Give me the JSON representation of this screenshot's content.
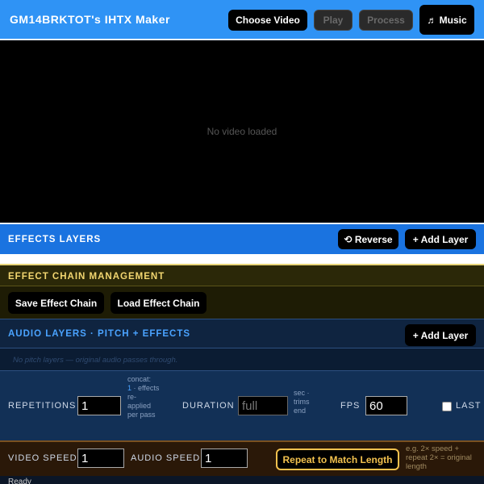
{
  "header": {
    "title": "GM14BRKTOT's IHTX Maker",
    "choose_video": "Choose Video",
    "play": "Play",
    "process": "Process",
    "music": "♬ Music"
  },
  "video": {
    "empty_message": "No video loaded"
  },
  "effects_layers": {
    "title": "EFFECTS LAYERS",
    "reverse": "⟲ Reverse",
    "add_layer": "+ Add Layer"
  },
  "effect_chain": {
    "title": "EFFECT CHAIN MANAGEMENT",
    "save": "Save Effect Chain",
    "load": "Load Effect Chain"
  },
  "audio_layers": {
    "title": "AUDIO LAYERS · PITCH + EFFECTS",
    "add_layer": "+ Add Layer",
    "hint": "No pitch layers — original audio passes through."
  },
  "settings": {
    "repetitions_label": "REPETITIONS",
    "repetitions_value": "1",
    "rep_note_1": "concat:",
    "rep_note_2": "1",
    "rep_note_3": "· effects re-applied per pass",
    "duration_label": "DURATION",
    "duration_placeholder": "full",
    "duration_note": "sec · trims end",
    "fps_label": "FPS",
    "fps_value": "60",
    "last_label": "LAST F"
  },
  "speed": {
    "video_speed_label": "VIDEO SPEED",
    "video_speed_value": "1",
    "audio_speed_label": "AUDIO SPEED",
    "audio_speed_value": "1",
    "repeat_button": "Repeat to Match Length",
    "note": "e.g. 2× speed + repeat 2× = original length"
  },
  "status": {
    "text": "Ready"
  }
}
